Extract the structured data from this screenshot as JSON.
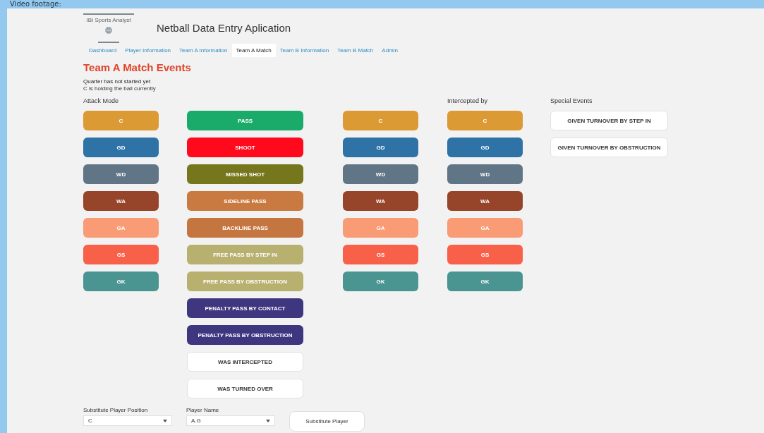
{
  "frame_caption": "Video footage:",
  "logo": {
    "caption": "IBI Sports Analyst"
  },
  "app_title": "Netball Data Entry Aplication",
  "tabs": [
    {
      "label": "Dashboard",
      "selected": false
    },
    {
      "label": "Player Information",
      "selected": false
    },
    {
      "label": "Team A Information",
      "selected": false
    },
    {
      "label": "Team A Match",
      "selected": true
    },
    {
      "label": "Team B Information",
      "selected": false
    },
    {
      "label": "Team B Match",
      "selected": false
    },
    {
      "label": "Admin",
      "selected": false
    }
  ],
  "page_title": "Team A Match Events",
  "status": [
    "Quarter has not started yet",
    "C is holding the ball currently"
  ],
  "columns": [
    {
      "heading": "Attack Mode",
      "buttons": [
        {
          "label": "C",
          "kind": "filled",
          "color": "#dc9a35"
        },
        {
          "label": "GD",
          "kind": "filled",
          "color": "#2e72a6"
        },
        {
          "label": "WD",
          "kind": "filled",
          "color": "#607585"
        },
        {
          "label": "WA",
          "kind": "filled",
          "color": "#96452b"
        },
        {
          "label": "GA",
          "kind": "filled",
          "color": "#f99b74"
        },
        {
          "label": "GS",
          "kind": "filled",
          "color": "#f9604a"
        },
        {
          "label": "GK",
          "kind": "filled",
          "color": "#4a9491"
        }
      ]
    },
    {
      "buttons": [
        {
          "label": "PASS",
          "kind": "filled",
          "color": "#1aab6a"
        },
        {
          "label": "SHOOT",
          "kind": "filled",
          "color": "#ff0a1c"
        },
        {
          "label": "MISSED SHOT",
          "kind": "filled",
          "color": "#76771c"
        },
        {
          "label": "SIDELINE PASS",
          "kind": "filled",
          "color": "#c97a40"
        },
        {
          "label": "BACKLINE PASS",
          "kind": "filled",
          "color": "#c57540"
        },
        {
          "label": "FREE PASS BY STEP IN",
          "kind": "filled",
          "color": "#b8b06e"
        },
        {
          "label": "FREE PASS BY OBSTRUCTION",
          "kind": "filled",
          "color": "#b8b06e"
        },
        {
          "label": "PENALTY PASS BY CONTACT",
          "kind": "filled",
          "color": "#3f3680"
        },
        {
          "label": "PENALTY PASS BY OBSTRUCTION",
          "kind": "filled",
          "color": "#3f3680"
        },
        {
          "label": "WAS INTERCEPTED",
          "kind": "plain",
          "color": "#ffffff"
        },
        {
          "label": "WAS TURNED OVER",
          "kind": "plain",
          "color": "#ffffff"
        }
      ]
    },
    {
      "buttons": [
        {
          "label": "C",
          "kind": "filled",
          "color": "#dc9a35"
        },
        {
          "label": "GD",
          "kind": "filled",
          "color": "#2e72a6"
        },
        {
          "label": "WD",
          "kind": "filled",
          "color": "#607585"
        },
        {
          "label": "WA",
          "kind": "filled",
          "color": "#96452b"
        },
        {
          "label": "GA",
          "kind": "filled",
          "color": "#f99b74"
        },
        {
          "label": "GS",
          "kind": "filled",
          "color": "#f9604a"
        },
        {
          "label": "GK",
          "kind": "filled",
          "color": "#4a9491"
        }
      ]
    },
    {
      "heading": "Intercepted by",
      "buttons": [
        {
          "label": "C",
          "kind": "filled",
          "color": "#dc9a35"
        },
        {
          "label": "GD",
          "kind": "filled",
          "color": "#2e72a6"
        },
        {
          "label": "WD",
          "kind": "filled",
          "color": "#607585"
        },
        {
          "label": "WA",
          "kind": "filled",
          "color": "#96452b"
        },
        {
          "label": "GA",
          "kind": "filled",
          "color": "#f99b74"
        },
        {
          "label": "GS",
          "kind": "filled",
          "color": "#f9604a"
        },
        {
          "label": "GK",
          "kind": "filled",
          "color": "#4a9491"
        }
      ]
    },
    {
      "heading": "Special Events",
      "buttons": [
        {
          "label": "GIVEN TURNOVER BY STEP IN",
          "kind": "plain",
          "color": "#ffffff"
        },
        {
          "label": "GIVEN TURNOVER BY OBSTRUCTION",
          "kind": "plain",
          "color": "#ffffff"
        }
      ]
    }
  ],
  "substitution": {
    "position": {
      "label": "Substitute Player Position",
      "value": "C"
    },
    "player": {
      "label": "Player Name",
      "value": "A.G"
    },
    "button": "Substitute Player"
  }
}
